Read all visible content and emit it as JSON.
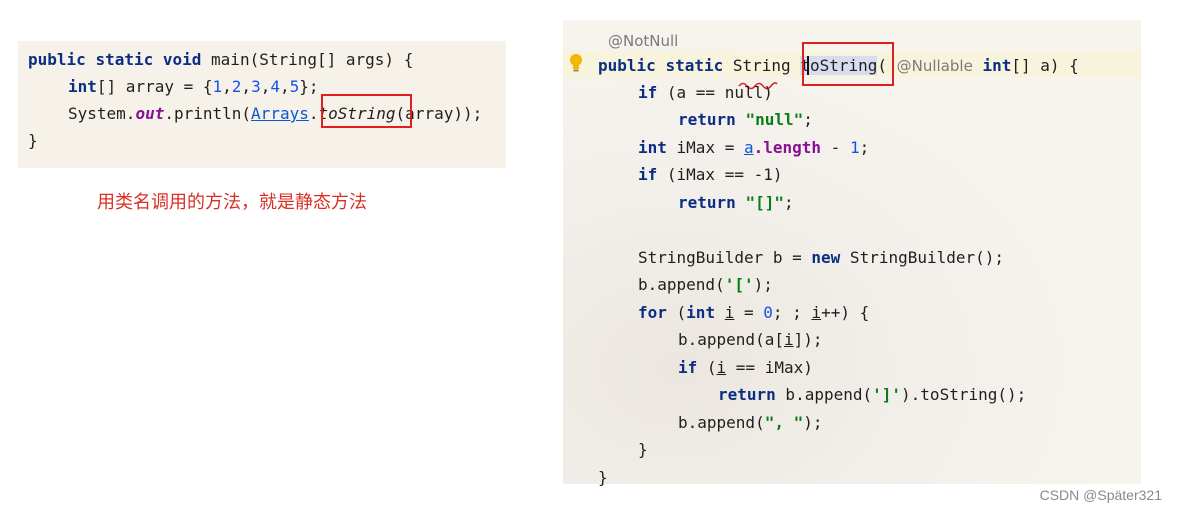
{
  "left_code": {
    "line1": {
      "kw1": "public",
      "kw2": "static",
      "kw3": "void",
      "rest": " main(String[] args) {"
    },
    "line2": {
      "kw": "int",
      "pre": "[] array = {",
      "n1": "1",
      "n2": "2",
      "n3": "3",
      "n4": "4",
      "n5": "5",
      "post": "};"
    },
    "line3": {
      "pre": "System.",
      "field": "out",
      "mid": ".println(",
      "cls": "Arrays",
      "dot": ".",
      "method": "toString",
      "post": "(array));"
    },
    "line4": "}"
  },
  "caption": "用类名调用的方法，就是静态方法",
  "right_code": {
    "annotation_notnull": "@NotNull",
    "sig": {
      "kw1": "public",
      "kw2": "static",
      "type": "String",
      "method": "toString",
      "paren": "(",
      "annotation_nullable": "@Nullable",
      "kw3": "int",
      "rest": "[] a) {"
    },
    "l2": {
      "kw": "if",
      "text": " (a == null)"
    },
    "l3": {
      "kw": "return",
      "str": "\"null\"",
      "semi": ";"
    },
    "l4": {
      "kw": "int",
      "pre": " iMax = ",
      "var": "a",
      "field": ".length",
      "op": " - ",
      "num": "1",
      "semi": ";"
    },
    "l5": {
      "kw": "if",
      "text": " (iMax == -1)"
    },
    "l6": {
      "kw": "return",
      "str": "\"[]\"",
      "semi": ";"
    },
    "l8": {
      "pre": "StringBuilder b = ",
      "kw": "new",
      "post": " StringBuilder();"
    },
    "l9": {
      "pre": "b.append(",
      "str": "'['",
      "post": ");"
    },
    "l10": {
      "kw1": "for",
      "p1": " (",
      "kw2": "int",
      "v1": "i",
      "p2": " = ",
      "num": "0",
      "p3": "; ; ",
      "v2": "i",
      "p4": "++) {"
    },
    "l11": {
      "pre": "b.append(a[",
      "v": "i",
      "post": "]);"
    },
    "l12": {
      "kw": "if",
      "p1": " (",
      "v": "i",
      "p2": " == iMax)"
    },
    "l13": {
      "kw": "return",
      "pre": " b.append(",
      "str": "']'",
      "post": ").toString();"
    },
    "l14": {
      "pre": "b.append(",
      "str": "\", \"",
      "post": ");"
    },
    "l15": "}",
    "l16": "}"
  },
  "watermark": "CSDN @Später321",
  "icons": {
    "bulb": "lightbulb-icon"
  },
  "colors": {
    "keyword": "#0b2e82",
    "number": "#1750eb",
    "string": "#067d17",
    "field": "#871094",
    "highlight_box": "#e02020",
    "caption": "#d93025"
  }
}
